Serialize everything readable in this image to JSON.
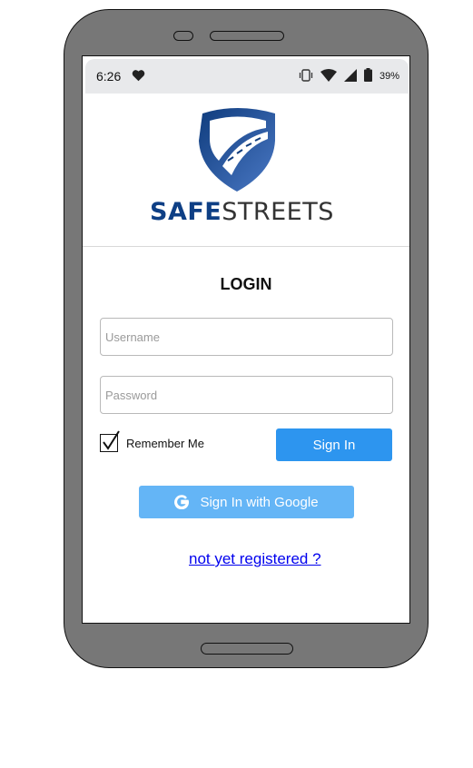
{
  "statusbar": {
    "time": "6:26",
    "battery_percent": "39%",
    "icons": [
      "heart-icon",
      "vibrate-icon",
      "wifi-icon",
      "signal-icon",
      "battery-icon"
    ]
  },
  "logo": {
    "brand_bold": "SAFE",
    "brand_light": "STREETS"
  },
  "login": {
    "title": "LOGIN",
    "username_placeholder": "Username",
    "password_placeholder": "Password",
    "remember_label": "Remember Me",
    "remember_checked": true,
    "signin_label": "Sign In",
    "google_label": "Sign In with Google",
    "register_link": "not yet registered ?"
  },
  "colors": {
    "primary": "#2d95ef",
    "google_button": "#64b5f6",
    "brand_dark": "#0e3f85",
    "link": "#0000ee",
    "statusbar_bg": "#e8e9eb",
    "phone_body": "#777777"
  }
}
